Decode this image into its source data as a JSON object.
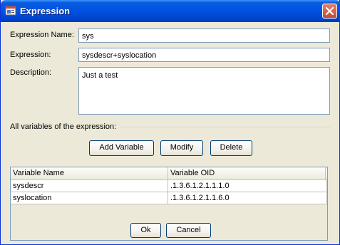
{
  "window": {
    "title": "Expression",
    "app_icon": "expression-window-icon",
    "close_icon": "close-icon"
  },
  "form": {
    "name_label": "Expression Name:",
    "name_value": "sys",
    "expression_label": "Expression:",
    "expression_value": "sysdescr+syslocation",
    "description_label": "Description:",
    "description_value": "Just a test",
    "variables_label": "All variables of the expression:"
  },
  "buttons": {
    "add_variable": "Add Variable",
    "modify": "Modify",
    "delete": "Delete",
    "ok": "Ok",
    "cancel": "Cancel"
  },
  "table": {
    "columns": [
      "Variable Name",
      "Variable OID"
    ],
    "rows": [
      [
        "sysdescr",
        ".1.3.6.1.2.1.1.1.0"
      ],
      [
        "syslocation",
        ".1.3.6.1.2.1.1.6.0"
      ]
    ]
  },
  "colors": {
    "titlebar": "#0054e3",
    "dialog_bg": "#ece9d8",
    "close_button": "#c84a2f"
  }
}
